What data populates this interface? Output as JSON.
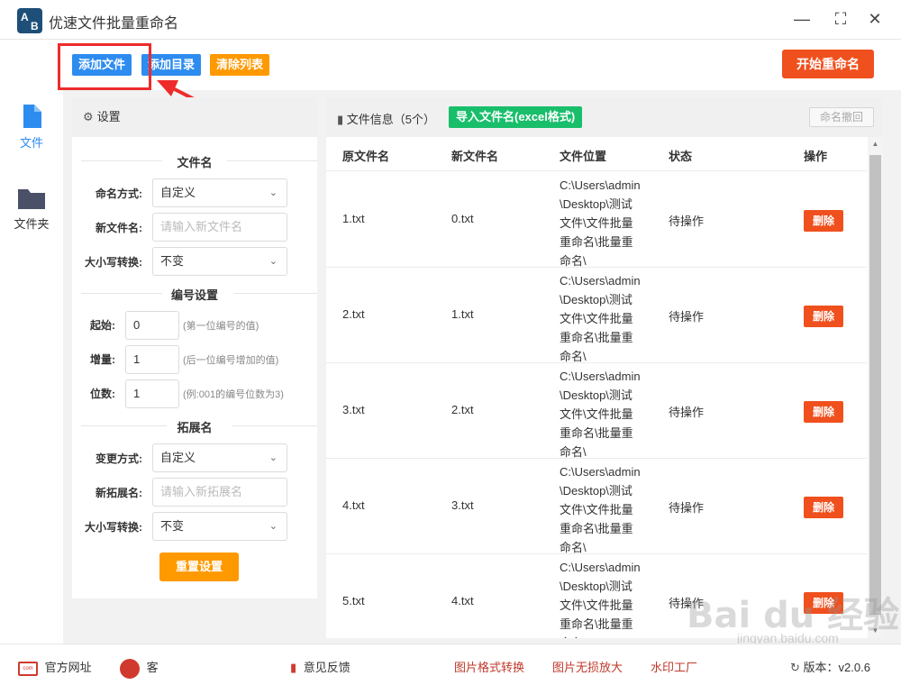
{
  "app": {
    "logo_text_a": "A",
    "logo_text_b": "B",
    "title": "优速文件批量重命名"
  },
  "window_controls": {
    "minimize": "—",
    "maximize": "⛶",
    "close": "✕"
  },
  "toolbar": {
    "add_files": "添加文件",
    "add_folder": "添加目录",
    "clear_list": "清除列表",
    "start_rename": "开始重命名"
  },
  "nav": {
    "files_label": "文件",
    "folder_label": "文件夹"
  },
  "settings": {
    "header": "设置",
    "filename_section": "文件名",
    "naming_mode_label": "命名方式:",
    "naming_mode_value": "自定义",
    "new_name_label": "新文件名:",
    "new_name_placeholder": "请输入新文件名",
    "case_label": "大小写转换:",
    "case_value": "不变",
    "numbering_section": "编号设置",
    "start_label": "起始:",
    "start_value": "0",
    "start_hint": "(第一位编号的值)",
    "step_label": "增量:",
    "step_value": "1",
    "step_hint": "(后一位编号增加的值)",
    "digits_label": "位数:",
    "digits_value": "1",
    "digits_hint": "(例:001的编号位数为3)",
    "ext_section": "拓展名",
    "ext_mode_label": "变更方式:",
    "ext_mode_value": "自定义",
    "new_ext_label": "新拓展名:",
    "new_ext_placeholder": "请输入新拓展名",
    "ext_case_label": "大小写转换:",
    "ext_case_value": "不变",
    "reset_button": "重置设置"
  },
  "filepanel": {
    "title": "文件信息（5个）",
    "import_button": "导入文件名(excel格式)",
    "undo_button": "命名撤回",
    "columns": [
      "原文件名",
      "新文件名",
      "文件位置",
      "状态",
      "操作"
    ],
    "rows": [
      {
        "orig": "1.txt",
        "new": "0.txt",
        "location": "C:\\Users\\admin\\Desktop\\测试文件\\文件批量重命名\\批量重命名\\",
        "status": "待操作",
        "action": "删除"
      },
      {
        "orig": "2.txt",
        "new": "1.txt",
        "location": "C:\\Users\\admin\\Desktop\\测试文件\\文件批量重命名\\批量重命名\\",
        "status": "待操作",
        "action": "删除"
      },
      {
        "orig": "3.txt",
        "new": "2.txt",
        "location": "C:\\Users\\admin\\Desktop\\测试文件\\文件批量重命名\\批量重命名\\",
        "status": "待操作",
        "action": "删除"
      },
      {
        "orig": "4.txt",
        "new": "3.txt",
        "location": "C:\\Users\\admin\\Desktop\\测试文件\\文件批量重命名\\批量重命名\\",
        "status": "待操作",
        "action": "删除"
      },
      {
        "orig": "5.txt",
        "new": "4.txt",
        "location": "C:\\Users\\admin\\Desktop\\测试文件\\文件批量重命名\\批量重命名\\",
        "status": "待操作",
        "action": "删除"
      }
    ]
  },
  "footer": {
    "website": "官方网址",
    "support": "客",
    "feedback": "意见反馈",
    "img_convert": "图片格式转换",
    "img_enlarge": "图片无损放大",
    "watermark_tool": "水印工厂",
    "version": "版本：v2.0.6"
  },
  "watermark": {
    "text": "Bai du 经验",
    "sub": "jingyan.baidu.com"
  },
  "colors": {
    "blue": "#2d8cf0",
    "orange": "#ff9900",
    "red": "#f0501e",
    "green": "#19be6b",
    "annotation": "#ee2b2b"
  }
}
